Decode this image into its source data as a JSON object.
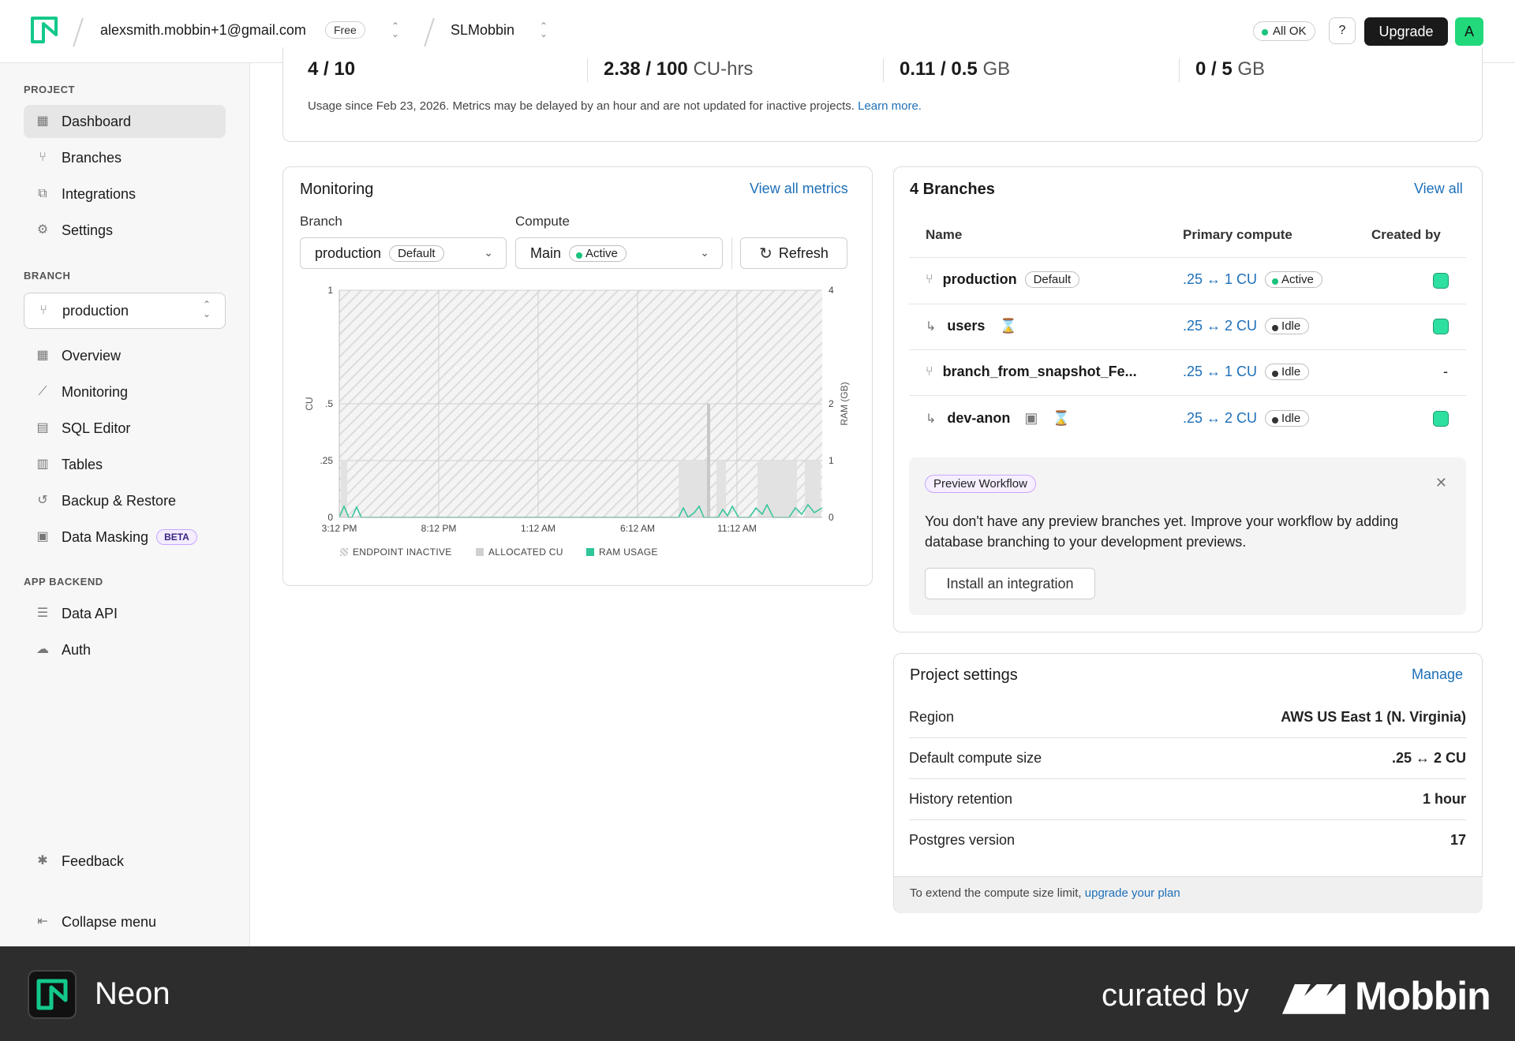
{
  "header": {
    "email": "alexsmith.mobbin+1@gmail.com",
    "plan_badge": "Free",
    "project": "SLMobbin",
    "status": "All OK",
    "help_icon": "?",
    "upgrade_label": "Upgrade",
    "avatar_letter": "A"
  },
  "sidebar": {
    "project_heading": "PROJECT",
    "project_items": [
      {
        "label": "Dashboard",
        "icon": "dashboard-icon"
      },
      {
        "label": "Branches",
        "icon": "branches-icon"
      },
      {
        "label": "Integrations",
        "icon": "integrations-icon"
      },
      {
        "label": "Settings",
        "icon": "gear-icon"
      }
    ],
    "branch_heading": "BRANCH",
    "branch_selected": "production",
    "branch_items": [
      {
        "label": "Overview",
        "icon": "overview-icon"
      },
      {
        "label": "Monitoring",
        "icon": "monitoring-icon"
      },
      {
        "label": "SQL Editor",
        "icon": "sql-editor-icon"
      },
      {
        "label": "Tables",
        "icon": "tables-icon"
      },
      {
        "label": "Backup & Restore",
        "icon": "backup-icon"
      },
      {
        "label": "Data Masking",
        "icon": "masking-icon",
        "badge": "BETA"
      }
    ],
    "backend_heading": "APP BACKEND",
    "backend_items": [
      {
        "label": "Data API",
        "icon": "data-api-icon"
      },
      {
        "label": "Auth",
        "icon": "auth-icon"
      }
    ],
    "feedback": "Feedback",
    "collapse": "Collapse menu"
  },
  "usage": {
    "metrics": [
      {
        "value": "4 / 10",
        "unit": ""
      },
      {
        "value": "2.38 / 100",
        "unit": "CU-hrs"
      },
      {
        "value": "0.11 / 0.5",
        "unit": "GB"
      },
      {
        "value": "0 / 5",
        "unit": "GB"
      }
    ],
    "note": "Usage since Feb 23, 2026. Metrics may be delayed by an hour and are not updated for inactive projects.",
    "learn_more": "Learn more."
  },
  "monitoring": {
    "title": "Monitoring",
    "view_all": "View all metrics",
    "branch_label": "Branch",
    "branch_value": "production",
    "branch_badge": "Default",
    "compute_label": "Compute",
    "compute_value": "Main",
    "compute_badge": "Active",
    "refresh": "Refresh",
    "legend": [
      "ENDPOINT INACTIVE",
      "ALLOCATED CU",
      "RAM USAGE"
    ]
  },
  "chart_data": {
    "type": "area",
    "x_ticks": [
      "3:12 PM",
      "8:12 PM",
      "1:12 AM",
      "6:12 AM",
      "11:12 AM"
    ],
    "y_left_ticks": [
      "1",
      ".5",
      ".25",
      "0"
    ],
    "y_right_ticks": [
      "4",
      "2",
      "1",
      "0"
    ],
    "ylabel_left": "CU",
    "ylabel_right": "RAM (GB)",
    "ylim_left": [
      0,
      1
    ],
    "ylim_right": [
      0,
      4
    ],
    "series": [
      {
        "name": "ENDPOINT INACTIVE",
        "color": "#d8d8d8"
      },
      {
        "name": "ALLOCATED CU",
        "color": "#cfcfcf",
        "values": [
          0.25,
          0.25,
          0.25,
          0.25,
          0.5,
          0.25,
          0.25
        ]
      },
      {
        "name": "RAM USAGE",
        "color": "#2ec59a",
        "values": [
          0.05,
          0.1,
          0.0,
          0.0,
          0.1,
          0.12,
          0.15
        ]
      }
    ]
  },
  "branches": {
    "title": "4 Branches",
    "view_all": "View all",
    "columns": [
      "Name",
      "Primary compute",
      "Created by"
    ],
    "rows": [
      {
        "name": "production",
        "badge": "Default",
        "icon": "branch-icon",
        "compute": ".25 ↔ 1 CU",
        "status": "Active",
        "creator": "avatar"
      },
      {
        "name": "users",
        "badge": "",
        "icon": "child-branch-icon",
        "extra_icon": "hourglass-icon",
        "compute": ".25 ↔ 2 CU",
        "status": "Idle",
        "creator": "avatar"
      },
      {
        "name": "branch_from_snapshot_Fe...",
        "badge": "",
        "icon": "branch-icon",
        "compute": ".25 ↔ 1 CU",
        "status": "Idle",
        "creator": "-"
      },
      {
        "name": "dev-anon",
        "badge": "",
        "icon": "child-branch-icon",
        "extra_icon": "hourglass-icon",
        "compute": ".25 ↔ 2 CU",
        "status": "Idle",
        "creator": "avatar"
      }
    ],
    "preview_badge": "Preview Workflow",
    "preview_text": "You don't have any preview branches yet. Improve your workflow by adding database branching to your development previews.",
    "preview_button": "Install an integration"
  },
  "settings": {
    "title": "Project settings",
    "manage": "Manage",
    "rows": [
      {
        "label": "Region",
        "value": "AWS US East 1 (N. Virginia)"
      },
      {
        "label": "Default compute size",
        "value": ".25 ↔ 2 CU"
      },
      {
        "label": "History retention",
        "value": "1 hour"
      },
      {
        "label": "Postgres version",
        "value": "17"
      }
    ],
    "foot_text": "To extend the compute size limit,",
    "foot_link": "upgrade your plan"
  },
  "footer": {
    "brand": "Neon",
    "curated": "curated by",
    "mobbin": "Mobbin"
  }
}
